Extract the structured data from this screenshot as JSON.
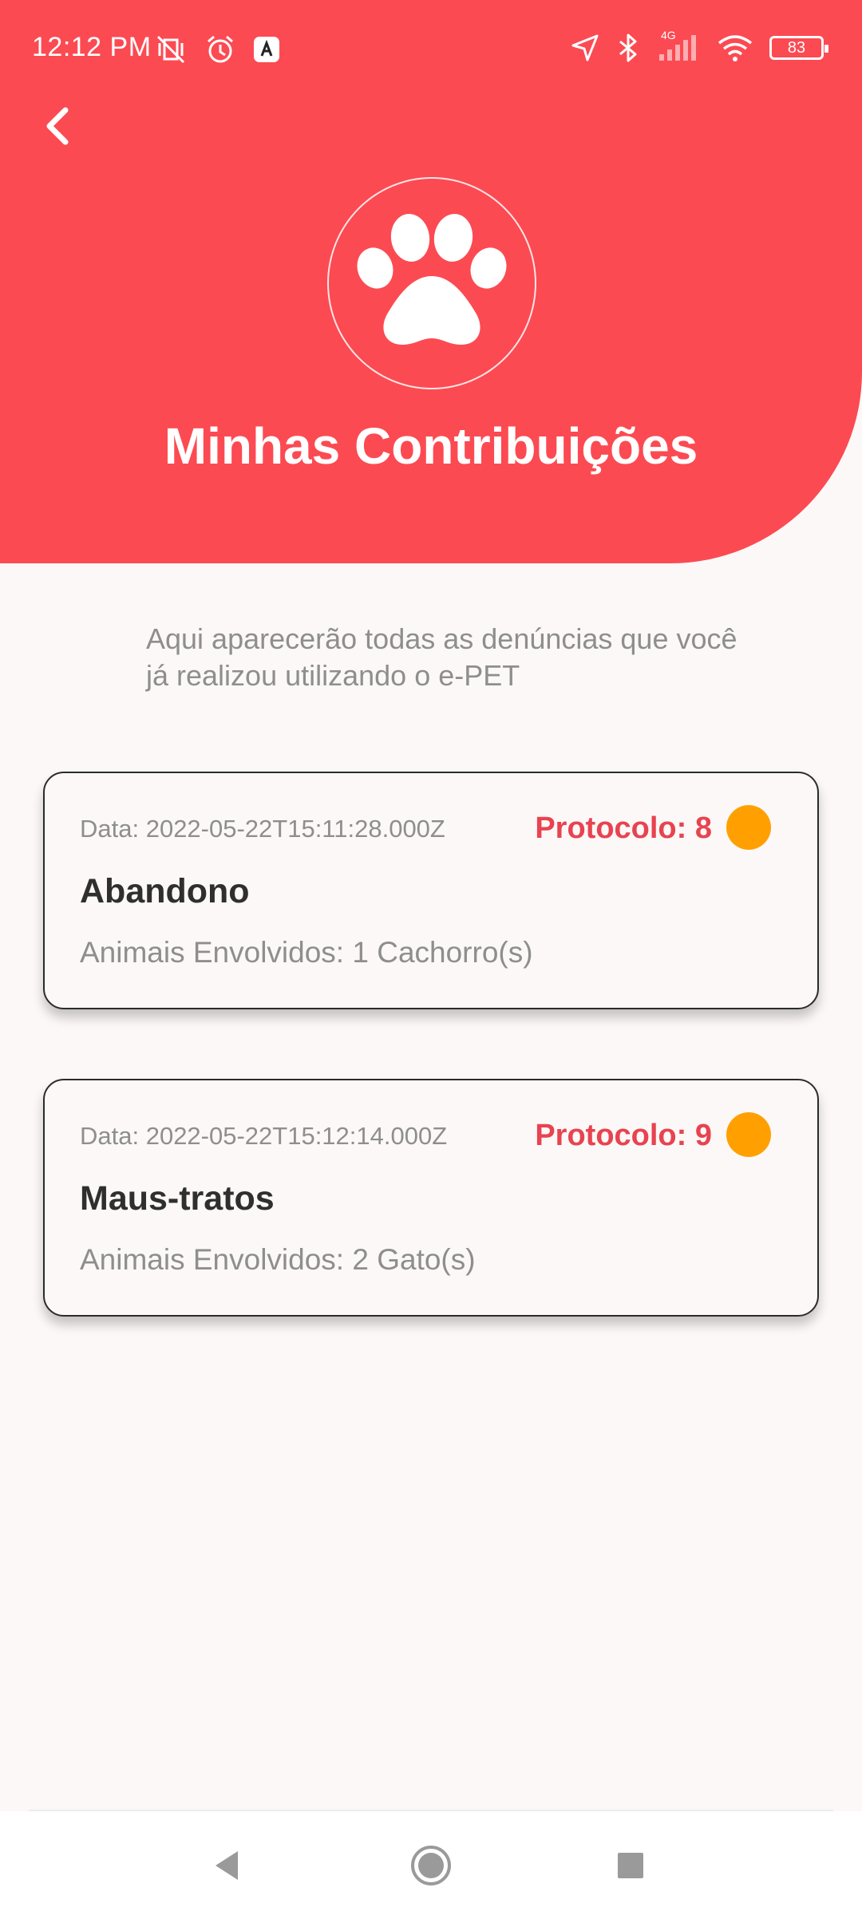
{
  "status_bar": {
    "time": "12:12 PM",
    "left_icons": [
      "mute-vibrate-icon",
      "alarm-icon",
      "app-notification-icon"
    ],
    "right_icons": [
      "location-icon",
      "bluetooth-icon",
      "signal-4g-icon",
      "wifi-icon"
    ],
    "network_label": "4G",
    "battery": "83"
  },
  "header": {
    "back_icon": "chevron-left-icon",
    "logo_icon": "paw-icon",
    "title": "Minhas Contribuições",
    "color": "#fc4a52"
  },
  "intro": {
    "text": "Aqui aparecerão todas as denúncias que você já realizou utilizando o e-PET"
  },
  "reports": [
    {
      "date": "Data: 2022-05-22T15:11:28.000Z",
      "protocol": "Protocolo: 8",
      "type": "Abandono",
      "animals": "Animais Envolvidos: 1 Cachorro(s)",
      "status_color": "#ffa000"
    },
    {
      "date": "Data: 2022-05-22T15:12:14.000Z",
      "protocol": "Protocolo: 9",
      "type": "Maus-tratos",
      "animals": "Animais Envolvidos: 2 Gato(s)",
      "status_color": "#ffa000"
    }
  ],
  "nav_bar": {
    "icons": [
      "nav-back-icon",
      "nav-home-icon",
      "nav-recents-icon"
    ]
  }
}
